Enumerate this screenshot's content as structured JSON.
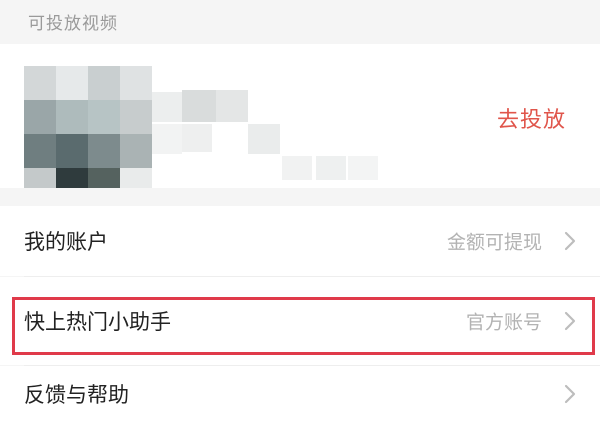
{
  "section": {
    "title": "可投放视频"
  },
  "video": {
    "cast_label": "去投放",
    "thumbnail_icon": "blurred-video-thumbnail"
  },
  "menu": [
    {
      "label": "我的账户",
      "value": "金额可提现",
      "icon": "chevron-right-icon",
      "highlighted": false
    },
    {
      "label": "快上热门小助手",
      "value": "官方账号",
      "icon": "chevron-right-icon",
      "highlighted": true
    },
    {
      "label": "反馈与帮助",
      "value": "",
      "icon": "chevron-right-icon",
      "highlighted": false
    }
  ],
  "colors": {
    "accent": "#e0554b",
    "highlight_border": "#e03a4a",
    "background": "#f5f5f5",
    "secondary_text": "#b3b3b3"
  }
}
